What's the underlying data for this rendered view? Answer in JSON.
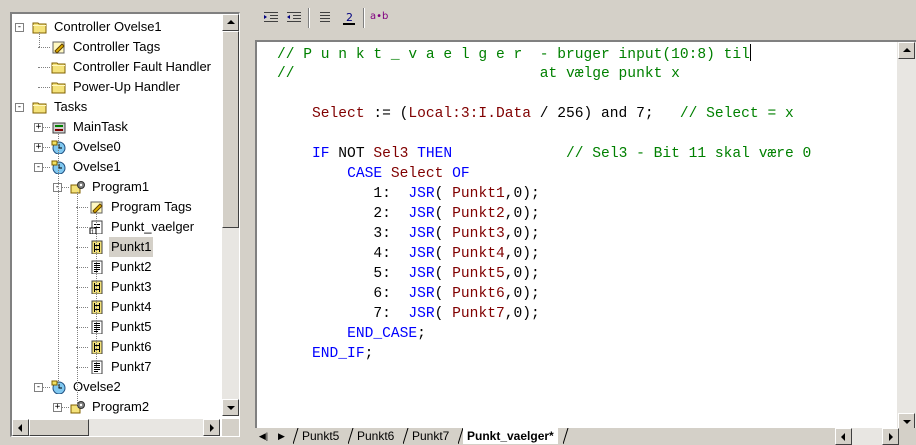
{
  "tree": {
    "items": [
      {
        "label": "Controller Ovelse1",
        "icon": "folder-icon",
        "level": 0,
        "expander": "minus"
      },
      {
        "label": "Controller Tags",
        "icon": "tags-icon",
        "level": 1
      },
      {
        "label": "Controller Fault Handler",
        "icon": "folder-icon",
        "level": 1
      },
      {
        "label": "Power-Up Handler",
        "icon": "folder-icon",
        "level": 1
      },
      {
        "label": "Tasks",
        "icon": "folder-icon",
        "level": 0,
        "expander": "minus"
      },
      {
        "label": "MainTask",
        "icon": "task-icon",
        "level": 1,
        "expander": "plus"
      },
      {
        "label": "Ovelse0",
        "icon": "periodic-task-icon",
        "level": 1,
        "expander": "plus"
      },
      {
        "label": "Ovelse1",
        "icon": "periodic-task-icon",
        "level": 1,
        "expander": "minus"
      },
      {
        "label": "Program1",
        "icon": "program-icon",
        "level": 2,
        "expander": "minus"
      },
      {
        "label": "Program Tags",
        "icon": "tags-icon",
        "level": 3
      },
      {
        "label": "Punkt_vaelger",
        "icon": "main-routine-icon",
        "level": 3
      },
      {
        "label": "Punkt1",
        "icon": "ladder-routine-icon",
        "level": 3,
        "selected": true
      },
      {
        "label": "Punkt2",
        "icon": "st-routine-icon",
        "level": 3
      },
      {
        "label": "Punkt3",
        "icon": "ladder-routine-icon",
        "level": 3
      },
      {
        "label": "Punkt4",
        "icon": "ladder-routine-icon",
        "level": 3
      },
      {
        "label": "Punkt5",
        "icon": "st-routine-icon",
        "level": 3
      },
      {
        "label": "Punkt6",
        "icon": "ladder-routine-icon",
        "level": 3
      },
      {
        "label": "Punkt7",
        "icon": "st-routine-icon",
        "level": 3
      },
      {
        "label": "Ovelse2",
        "icon": "periodic-task-icon",
        "level": 1,
        "expander": "minus"
      },
      {
        "label": "Program2",
        "icon": "program-icon",
        "level": 2,
        "expander": "plus"
      }
    ]
  },
  "toolbar": {
    "buttons": [
      "indent-icon",
      "outdent-icon",
      "comment-icon",
      "uncomment-icon",
      "ab-icon"
    ],
    "ab_label": "a•b"
  },
  "editor": {
    "lines": [
      [
        {
          "t": "// P u n k t _ v a e l g e r  - bruger input(10:8) til",
          "c": "cm"
        }
      ],
      [
        {
          "t": "//                            at vælge punkt x",
          "c": "cm"
        }
      ],
      [],
      [
        {
          "t": "    ",
          "c": "pl"
        },
        {
          "t": "Select",
          "c": "tg"
        },
        {
          "t": " := (",
          "c": "pl"
        },
        {
          "t": "Local:3:I.Data",
          "c": "tg"
        },
        {
          "t": " / 256) and 7;   ",
          "c": "pl"
        },
        {
          "t": "// Select = x",
          "c": "cm"
        }
      ],
      [],
      [
        {
          "t": "    ",
          "c": "pl"
        },
        {
          "t": "IF",
          "c": "kw"
        },
        {
          "t": " NOT ",
          "c": "pl"
        },
        {
          "t": "Sel3",
          "c": "tg"
        },
        {
          "t": " ",
          "c": "pl"
        },
        {
          "t": "THEN",
          "c": "kw"
        },
        {
          "t": "             ",
          "c": "pl"
        },
        {
          "t": "// Sel3 - Bit 11 skal være 0",
          "c": "cm"
        }
      ],
      [
        {
          "t": "        ",
          "c": "pl"
        },
        {
          "t": "CASE",
          "c": "kw"
        },
        {
          "t": " ",
          "c": "pl"
        },
        {
          "t": "Select",
          "c": "tg"
        },
        {
          "t": " ",
          "c": "pl"
        },
        {
          "t": "OF",
          "c": "kw"
        }
      ],
      [
        {
          "t": "           1:  ",
          "c": "pl"
        },
        {
          "t": "JSR",
          "c": "kw"
        },
        {
          "t": "( ",
          "c": "pl"
        },
        {
          "t": "Punkt1",
          "c": "tg"
        },
        {
          "t": ",0);",
          "c": "pl"
        }
      ],
      [
        {
          "t": "           2:  ",
          "c": "pl"
        },
        {
          "t": "JSR",
          "c": "kw"
        },
        {
          "t": "( ",
          "c": "pl"
        },
        {
          "t": "Punkt2",
          "c": "tg"
        },
        {
          "t": ",0);",
          "c": "pl"
        }
      ],
      [
        {
          "t": "           3:  ",
          "c": "pl"
        },
        {
          "t": "JSR",
          "c": "kw"
        },
        {
          "t": "( ",
          "c": "pl"
        },
        {
          "t": "Punkt3",
          "c": "tg"
        },
        {
          "t": ",0);",
          "c": "pl"
        }
      ],
      [
        {
          "t": "           4:  ",
          "c": "pl"
        },
        {
          "t": "JSR",
          "c": "kw"
        },
        {
          "t": "( ",
          "c": "pl"
        },
        {
          "t": "Punkt4",
          "c": "tg"
        },
        {
          "t": ",0);",
          "c": "pl"
        }
      ],
      [
        {
          "t": "           5:  ",
          "c": "pl"
        },
        {
          "t": "JSR",
          "c": "kw"
        },
        {
          "t": "( ",
          "c": "pl"
        },
        {
          "t": "Punkt5",
          "c": "tg"
        },
        {
          "t": ",0);",
          "c": "pl"
        }
      ],
      [
        {
          "t": "           6:  ",
          "c": "pl"
        },
        {
          "t": "JSR",
          "c": "kw"
        },
        {
          "t": "( ",
          "c": "pl"
        },
        {
          "t": "Punkt6",
          "c": "tg"
        },
        {
          "t": ",0);",
          "c": "pl"
        }
      ],
      [
        {
          "t": "           7:  ",
          "c": "pl"
        },
        {
          "t": "JSR",
          "c": "kw"
        },
        {
          "t": "( ",
          "c": "pl"
        },
        {
          "t": "Punkt7",
          "c": "tg"
        },
        {
          "t": ",0);",
          "c": "pl"
        }
      ],
      [
        {
          "t": "        ",
          "c": "pl"
        },
        {
          "t": "END_CASE",
          "c": "kw"
        },
        {
          "t": ";",
          "c": "pl"
        }
      ],
      [
        {
          "t": "    ",
          "c": "pl"
        },
        {
          "t": "END_IF",
          "c": "kw"
        },
        {
          "t": ";",
          "c": "pl"
        }
      ]
    ],
    "colors": {
      "comment": "#008000",
      "keyword": "#0000ff",
      "tag": "#800000",
      "plain": "#000000"
    }
  },
  "tabs": {
    "items": [
      {
        "label": "Punkt5",
        "active": false
      },
      {
        "label": "Punkt6",
        "active": false
      },
      {
        "label": "Punkt7",
        "active": false
      },
      {
        "label": "Punkt_vaelger*",
        "active": true
      }
    ]
  }
}
